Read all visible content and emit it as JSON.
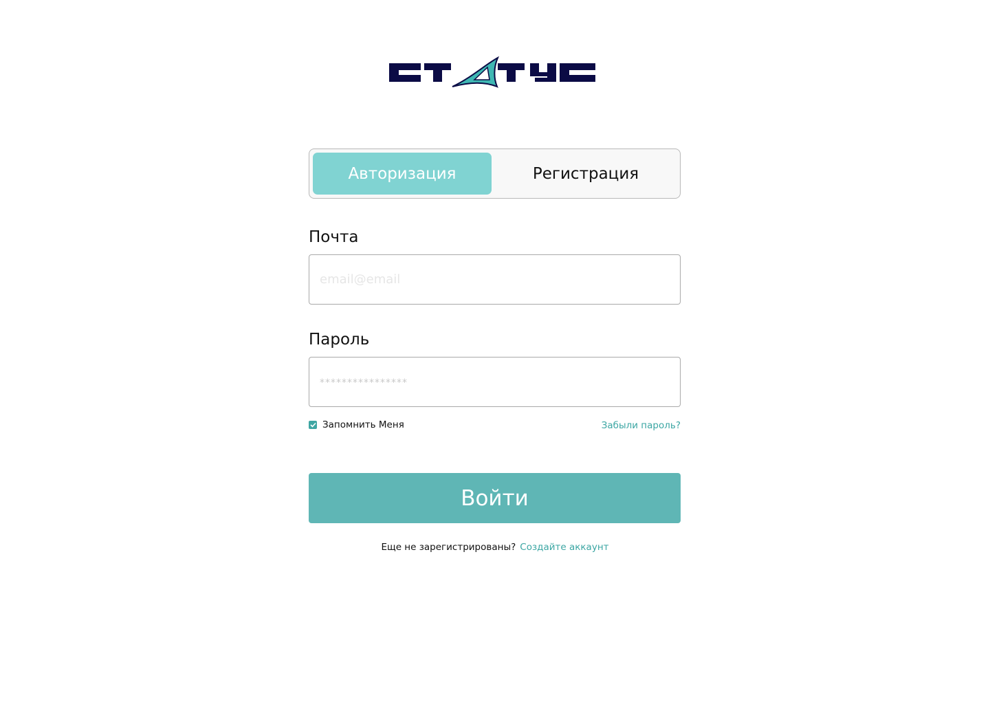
{
  "brand": {
    "logo_text": "СТАТУС",
    "colors": {
      "dark": "#0b0b45",
      "accent": "#3fb7b3"
    }
  },
  "tabs": {
    "login_label": "Авторизация",
    "register_label": "Регистрация",
    "active": "login"
  },
  "form": {
    "email_label": "Почта",
    "email_placeholder": "email@email",
    "email_value": "",
    "password_label": "Пароль",
    "password_placeholder": "****************",
    "password_value": "",
    "remember_label": "Запомнить Меня",
    "remember_checked": true,
    "forgot_label": "Забыли пароль?",
    "submit_label": "Войти"
  },
  "footer": {
    "question": "Еще не зарегистрированы?",
    "create_link": "Создайте аккаунт"
  },
  "theme": {
    "tab_active_bg": "#80d3d2",
    "button_bg": "#5fb6b5",
    "link_color": "#3ba6a3"
  }
}
